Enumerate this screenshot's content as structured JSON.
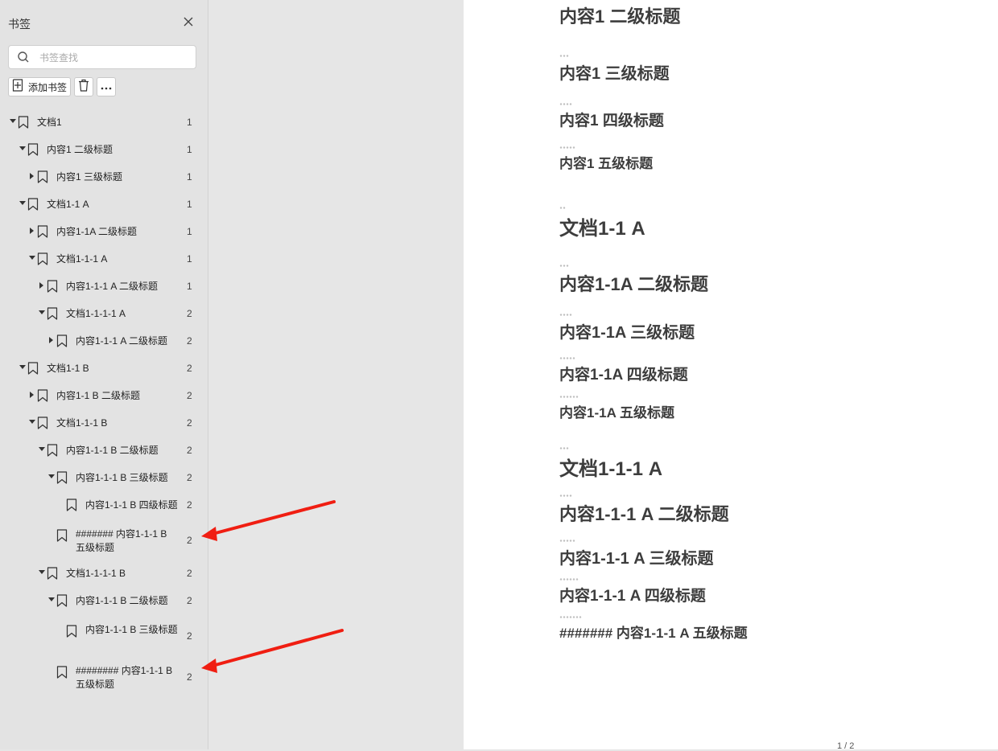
{
  "sidebar": {
    "title": "书签",
    "search_placeholder": "书签查找",
    "add_label": "添加书签",
    "items": [
      {
        "label": "文档1",
        "page": "1",
        "expanded": true
      },
      {
        "label": "内容1  二级标题",
        "page": "1",
        "expanded": true
      },
      {
        "label": "内容1  三级标题",
        "page": "1",
        "expanded": false
      },
      {
        "label": "文档1-1 A",
        "page": "1",
        "expanded": true
      },
      {
        "label": "内容1-1A  二级标题",
        "page": "1",
        "expanded": false
      },
      {
        "label": "文档1-1-1 A",
        "page": "1",
        "expanded": true
      },
      {
        "label": "内容1-1-1 A  二级标题",
        "page": "1",
        "expanded": false
      },
      {
        "label": "文档1-1-1-1 A",
        "page": "2",
        "expanded": true
      },
      {
        "label": "内容1-1-1 A  二级标题",
        "page": "2",
        "expanded": false
      },
      {
        "label": "文档1-1 B",
        "page": "2",
        "expanded": true
      },
      {
        "label": "内容1-1 B  二级标题",
        "page": "2",
        "expanded": false
      },
      {
        "label": "文档1-1-1 B",
        "page": "2",
        "expanded": true
      },
      {
        "label": "内容1-1-1 B  二级标题",
        "page": "2",
        "expanded": true
      },
      {
        "label": "内容1-1-1 B  三级标题",
        "page": "2",
        "expanded": true
      },
      {
        "label": "内容1-1-1 B 四级标题",
        "page": "2",
        "expanded": null
      },
      {
        "label": "####### 内容1-1-1 B 五级标题",
        "page": "2",
        "expanded": null
      },
      {
        "label": "文档1-1-1-1 B",
        "page": "2",
        "expanded": true
      },
      {
        "label": "内容1-1-1 B  二级标题",
        "page": "2",
        "expanded": true
      },
      {
        "label": "内容1-1-1 B  三级标题",
        "page": "2",
        "expanded": null
      },
      {
        "label": "######## 内容1-1-1 B 五级标题",
        "page": "2",
        "expanded": null
      }
    ]
  },
  "document": {
    "headings": [
      "内容1  二级标题",
      "内容1  三级标题",
      "内容1  四级标题",
      "内容1  五级标题",
      "文档1-1 A",
      "内容1-1A  二级标题",
      "内容1-1A  三级标题",
      "内容1-1A  四级标题",
      "内容1-1A  五级标题",
      "文档1-1-1 A",
      "内容1-1-1 A  二级标题",
      "内容1-1-1 A  三级标题",
      "内容1-1-1 A  四级标题",
      "####### 内容1-1-1 A  五级标题"
    ],
    "page_indicator": "1 / 2"
  },
  "colors": {
    "annotation_arrow": "#f01e12",
    "heading_text": "#3d3d3d",
    "sidebar_bg": "#e3e3e3"
  }
}
